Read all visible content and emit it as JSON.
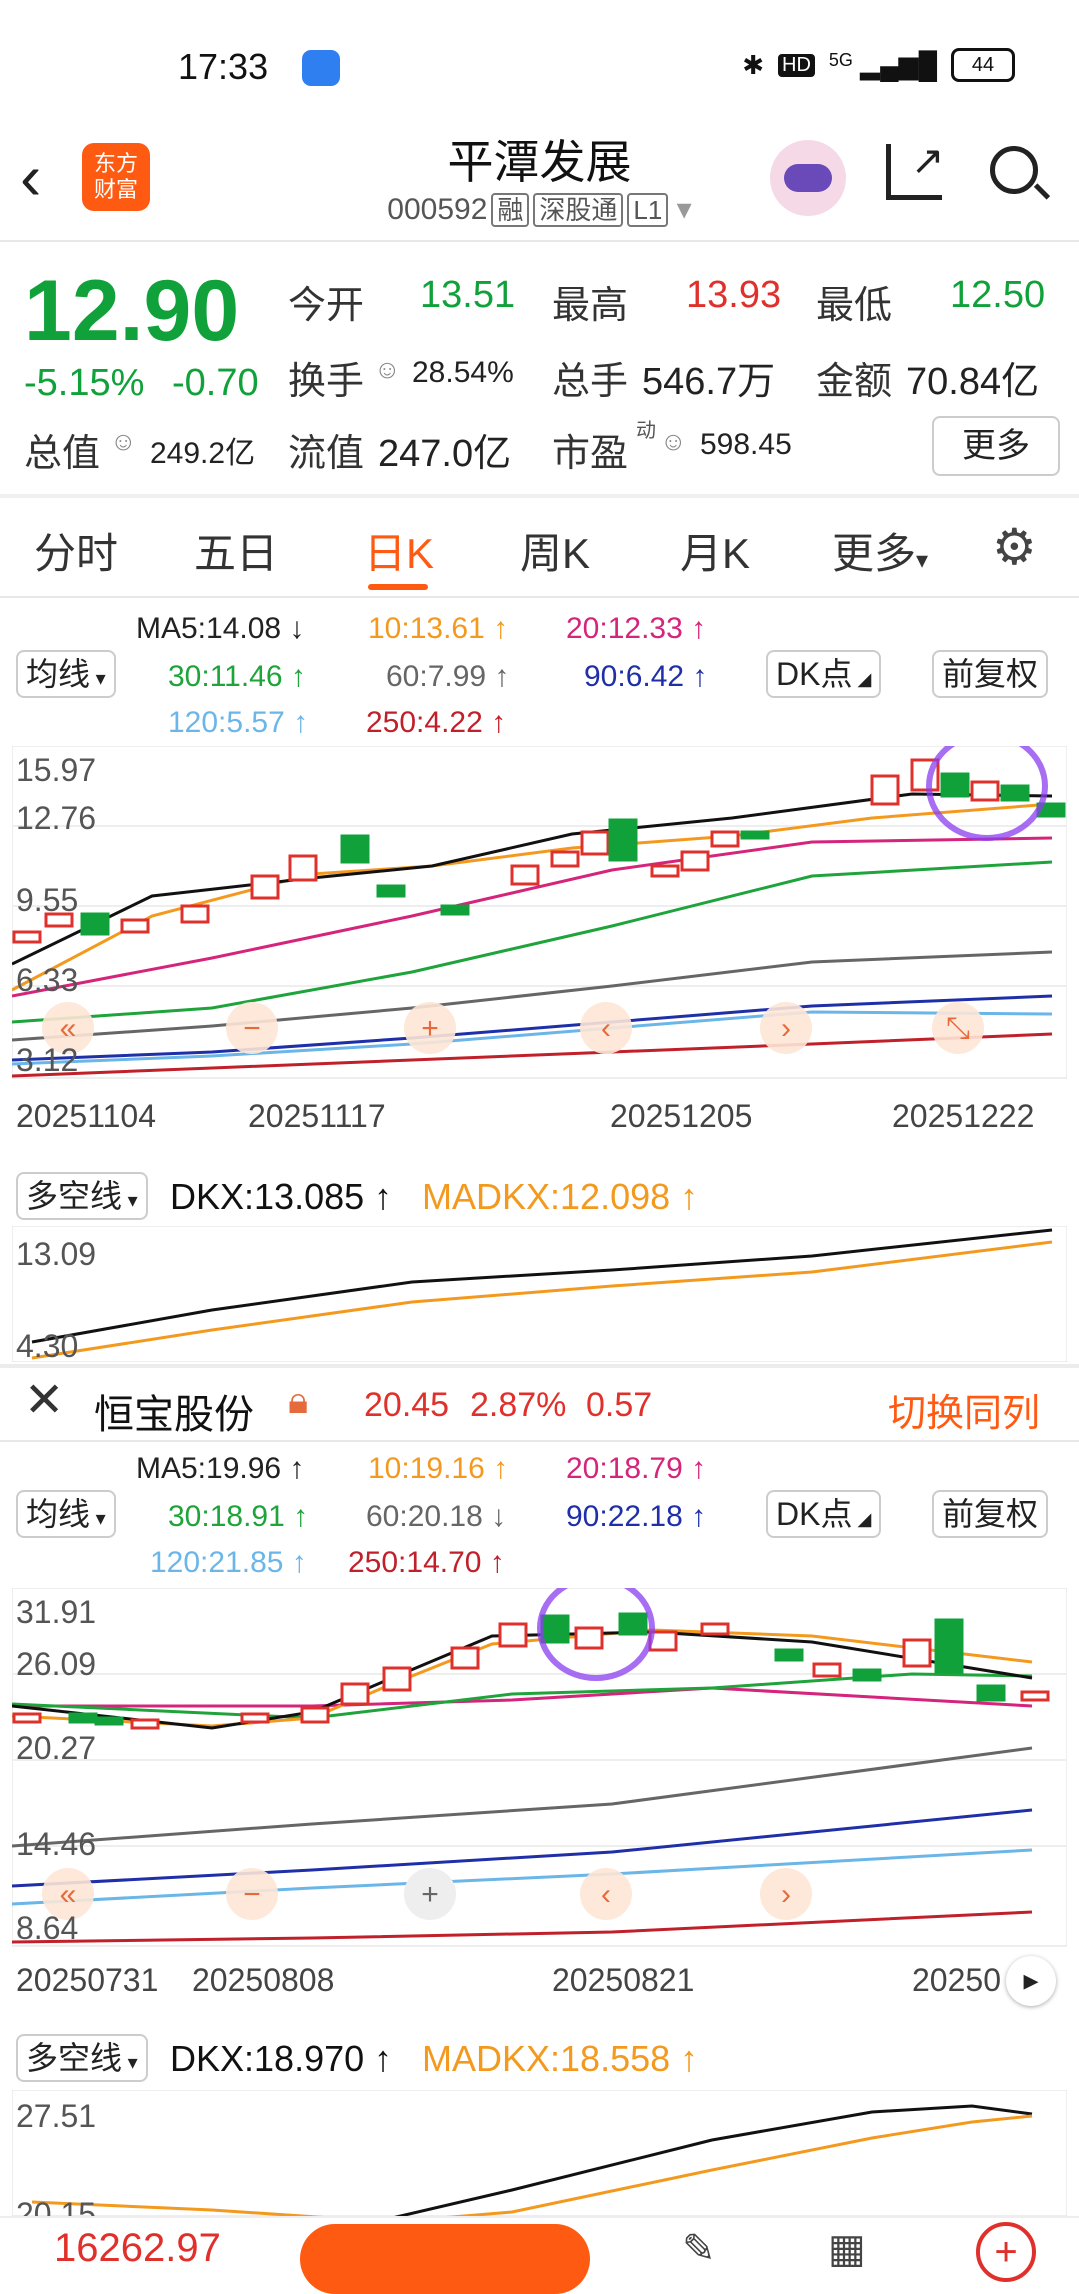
{
  "status": {
    "time": "17:33",
    "hd": "HD",
    "net": "5G",
    "battery": "44"
  },
  "header": {
    "title": "平潭发展",
    "code": "000592",
    "tags": [
      "融",
      "深股通",
      "L1"
    ],
    "logo_text": "东方\n财富"
  },
  "quote": {
    "price": "12.90",
    "pct": "-5.15%",
    "chg": "-0.70",
    "open_label": "今开",
    "open": "13.51",
    "high_label": "最高",
    "high": "13.93",
    "low_label": "最低",
    "low": "12.50",
    "turnover_label": "换手",
    "turnover": "28.54%",
    "vol_label": "总手",
    "vol": "546.7万",
    "amt_label": "金额",
    "amt": "70.84亿",
    "mcap_label": "总值",
    "mcap": "249.2亿",
    "float_label": "流值",
    "float": "247.0亿",
    "pe_label": "市盈",
    "pe_sup": "动",
    "pe": "598.45",
    "more": "更多"
  },
  "tabs": [
    "分时",
    "五日",
    "日K",
    "周K",
    "月K",
    "更多"
  ],
  "chart1": {
    "ma_btn": "均线",
    "dk_btn": "DK点",
    "fq_btn": "前复权",
    "ma5": "MA5:14.08",
    "ma10": "10:13.61",
    "ma20": "20:12.33",
    "ma30": "30:11.46",
    "ma60": "60:7.99",
    "ma90": "90:6.42",
    "ma120": "120:5.57",
    "ma250": "250:4.22",
    "y": [
      "15.97",
      "12.76",
      "9.55",
      "6.33",
      "3.12"
    ],
    "x": [
      "20251104",
      "20251117",
      "20251205",
      "20251222"
    ],
    "dkx_btn": "多空线",
    "dkx": "DKX:13.085",
    "madkx": "MADKX:12.098",
    "dy": [
      "13.09",
      "4.30"
    ]
  },
  "compare": {
    "name": "恒宝股份",
    "price": "20.45",
    "pct": "2.87%",
    "chg": "0.57",
    "switch": "切换同列"
  },
  "chart2": {
    "ma_btn": "均线",
    "dk_btn": "DK点",
    "fq_btn": "前复权",
    "ma5": "MA5:19.96",
    "ma10": "10:19.16",
    "ma20": "20:18.79",
    "ma30": "30:18.91",
    "ma60": "60:20.18",
    "ma90": "90:22.18",
    "ma120": "120:21.85",
    "ma250": "250:14.70",
    "y": [
      "31.91",
      "26.09",
      "20.27",
      "14.46",
      "8.64"
    ],
    "x": [
      "20250731",
      "20250808",
      "20250821",
      "20250"
    ],
    "dkx_btn": "多空线",
    "dkx": "DKX:18.970",
    "madkx": "MADKX:18.558",
    "dy": [
      "27.51",
      "20.15"
    ]
  },
  "bottom": {
    "index": "16262.97"
  },
  "colors": {
    "accent": "#ff5a11",
    "up": "#e0302b",
    "down": "#11a13a"
  }
}
